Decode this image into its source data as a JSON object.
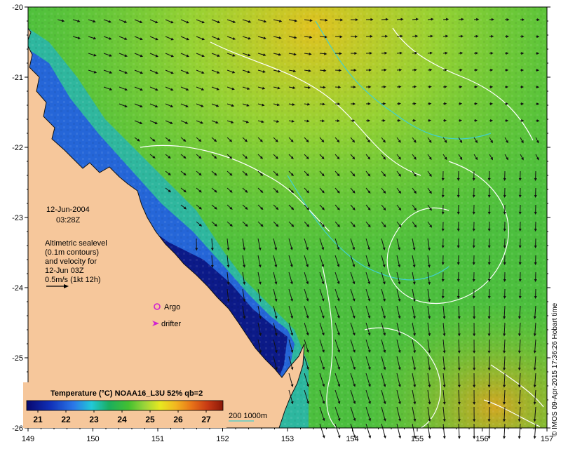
{
  "map": {
    "date_line": "12-Jun-2004",
    "time_line": "03:28Z",
    "altimetric_lines": [
      "Altimetric sealevel",
      "(0.1m contours)",
      "and velocity for",
      "12-Jun 03Z",
      "0.5m/s (1kt 12h)"
    ],
    "argo_label": "Argo",
    "drifter_label": "drifter",
    "colorbar_title": "Temperature (°C) NOAA16_L3U 52% qb=2",
    "colorbar_ticks": [
      "21",
      "22",
      "23",
      "24",
      "25",
      "26",
      "27"
    ],
    "colorbar_min": 20.6,
    "colorbar_max": 27.6,
    "bathy_label": "200  1000m",
    "credit": "© IMOS 09-Apr-2015 17:36:26 Hobart time",
    "x_ticks": [
      "149",
      "150",
      "151",
      "152",
      "153",
      "154",
      "155",
      "156",
      "157"
    ],
    "y_ticks": [
      "-20",
      "-21",
      "-22",
      "-23",
      "-24",
      "-25",
      "-26"
    ],
    "lon_range": [
      149,
      157
    ],
    "lat_range": [
      -26,
      -20
    ],
    "colors": {
      "land": "#f6c79b",
      "coast": "#111111",
      "contour": "#ffffff",
      "bathy": "#40d0d0",
      "arrow": "#111111",
      "argo": "#d020d0",
      "drifter": "#d020d0"
    }
  }
}
